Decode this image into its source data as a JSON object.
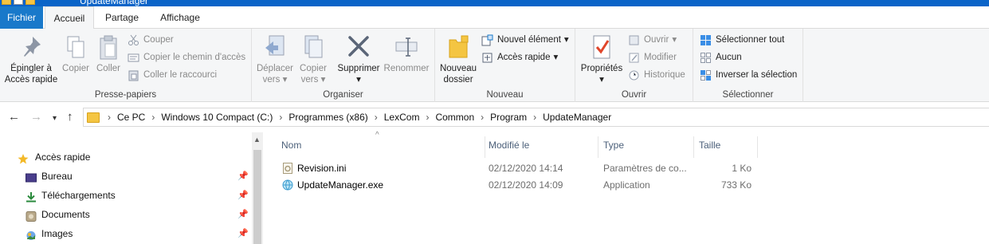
{
  "window": {
    "title": "UpdateManager"
  },
  "ribbon_tabs": [
    {
      "label": "Fichier"
    },
    {
      "label": "Accueil"
    },
    {
      "label": "Partage"
    },
    {
      "label": "Affichage"
    }
  ],
  "clipboard": {
    "group_label": "Presse-papiers",
    "pin_label_1": "Épingler à",
    "pin_label_2": "Accès rapide",
    "copy_label": "Copier",
    "paste_label": "Coller",
    "cut_label": "Couper",
    "copy_path_label": "Copier le chemin d'accès",
    "paste_shortcut_label": "Coller le raccourci"
  },
  "organize": {
    "group_label": "Organiser",
    "move_label_1": "Déplacer",
    "move_label_2": "vers",
    "copyto_label_1": "Copier",
    "copyto_label_2": "vers",
    "delete_label": "Supprimer",
    "rename_label": "Renommer"
  },
  "new": {
    "group_label": "Nouveau",
    "new_folder_label_1": "Nouveau",
    "new_folder_label_2": "dossier",
    "new_item_label": "Nouvel élément",
    "easy_access_label": "Accès rapide"
  },
  "open": {
    "group_label": "Ouvrir",
    "properties_label": "Propriétés",
    "open_label": "Ouvrir",
    "edit_label": "Modifier",
    "history_label": "Historique"
  },
  "select": {
    "group_label": "Sélectionner",
    "select_all_label": "Sélectionner tout",
    "select_none_label": "Aucun",
    "invert_label": "Inverser la sélection"
  },
  "address": {
    "crumbs": [
      "Ce PC",
      "Windows 10 Compact  (C:)",
      "Programmes (x86)",
      "LexCom",
      "Common",
      "Program",
      "UpdateManager"
    ]
  },
  "nav_pane": {
    "items": [
      {
        "label": "Accès rapide",
        "icon": "star-icon"
      },
      {
        "label": "Bureau",
        "icon": "desktop-icon"
      },
      {
        "label": "Téléchargements",
        "icon": "download-icon"
      },
      {
        "label": "Documents",
        "icon": "documents-icon"
      },
      {
        "label": "Images",
        "icon": "pictures-icon"
      }
    ]
  },
  "columns": {
    "name": "Nom",
    "modified": "Modifié le",
    "type": "Type",
    "size": "Taille"
  },
  "files": [
    {
      "name": "Revision.ini",
      "modified": "02/12/2020 14:14",
      "type": "Paramètres de co...",
      "size": "1 Ko",
      "icon": "settings-file-icon"
    },
    {
      "name": "UpdateManager.exe",
      "modified": "02/12/2020 14:09",
      "type": "Application",
      "size": "733 Ko",
      "icon": "globe-app-icon"
    }
  ],
  "colors": {
    "accent": "#1979ca",
    "titlebar": "#0a64c8",
    "folder": "#f4c542"
  }
}
